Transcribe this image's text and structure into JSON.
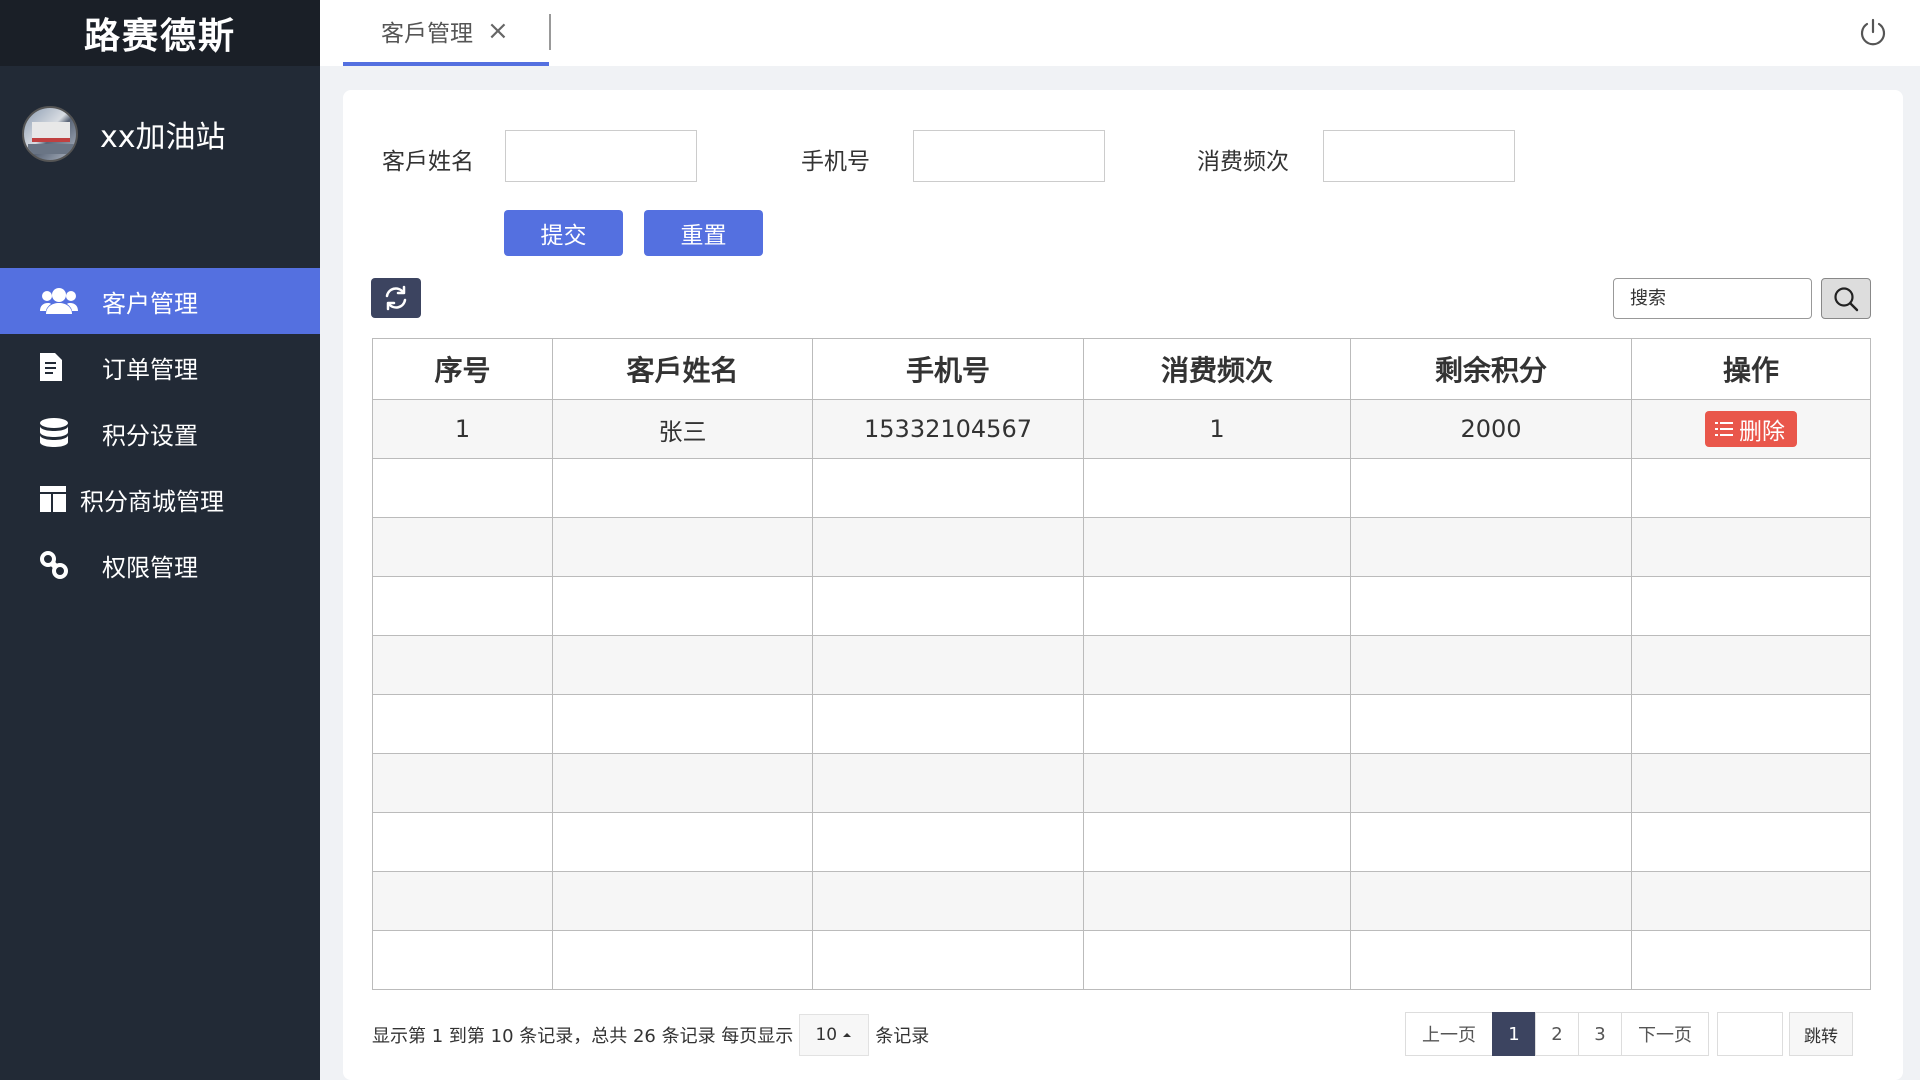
{
  "app": {
    "brand": "路赛德斯",
    "account_name": "xx加油站"
  },
  "sidebar": {
    "items": [
      {
        "label": "客户管理",
        "icon": "users-icon",
        "active": true
      },
      {
        "label": "订单管理",
        "icon": "document-icon",
        "active": false
      },
      {
        "label": "积分设置",
        "icon": "database-icon",
        "active": false
      },
      {
        "label": "积分商城管理",
        "icon": "columns-icon",
        "active": false
      },
      {
        "label": "权限管理",
        "icon": "link-icon",
        "active": false
      }
    ]
  },
  "tabs": [
    {
      "label": "客戶管理",
      "close": "×"
    }
  ],
  "form": {
    "name_label": "客戶姓名",
    "phone_label": "手机号",
    "freq_label": "消费频次",
    "name_value": "",
    "phone_value": "",
    "freq_value": "",
    "submit_label": "提交",
    "reset_label": "重置"
  },
  "search": {
    "placeholder": "搜索"
  },
  "table": {
    "headers": [
      "序号",
      "客戶姓名",
      "手机号",
      "消费频次",
      "剩余积分",
      "操作"
    ],
    "rows": [
      {
        "index": "1",
        "name": "张三",
        "phone": "15332104567",
        "frequency": "1",
        "points": "2000",
        "action": "删除"
      }
    ],
    "empty_rows": 9
  },
  "pagination": {
    "info_prefix": "显示第 1 到第 10 条记录，总共 26 条记录 每页显示",
    "page_size": "10",
    "info_suffix": "条记录",
    "prev": "上一页",
    "pages": [
      "1",
      "2",
      "3"
    ],
    "current_page": "1",
    "next": "下一页",
    "jump_value": "",
    "jump_label": "跳转"
  },
  "colors": {
    "accent": "#5470e0",
    "sidebar_bg": "#222a36",
    "danger": "#e9574b",
    "dark_button": "#3c4460"
  }
}
